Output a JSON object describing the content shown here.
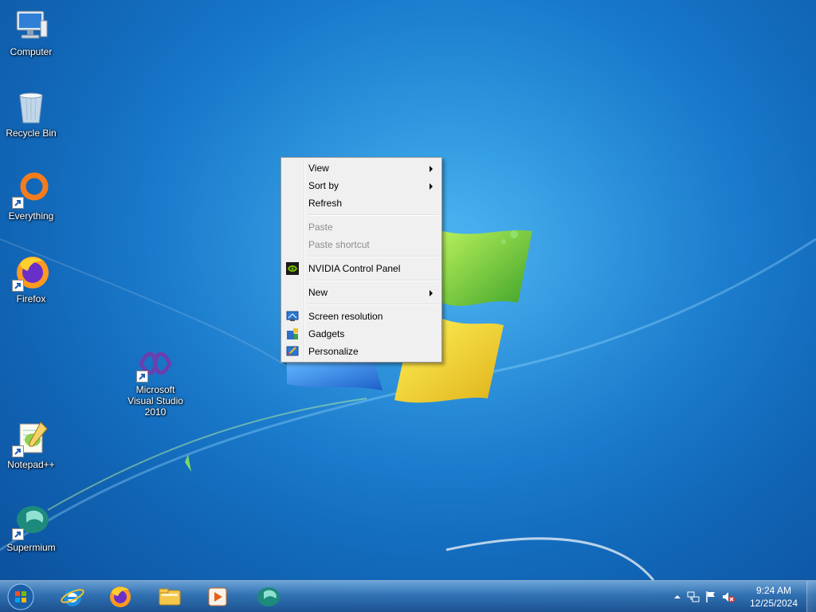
{
  "desktop": {
    "icons": [
      {
        "label": "Computer",
        "icon": "computer-icon"
      },
      {
        "label": "Recycle Bin",
        "icon": "recycle-bin-icon"
      },
      {
        "label": "Everything",
        "icon": "everything-icon"
      },
      {
        "label": "Firefox",
        "icon": "firefox-icon"
      },
      {
        "label": "Microsoft\nVisual Studio\n2010",
        "icon": "visual-studio-icon"
      },
      {
        "label": "Notepad++",
        "icon": "notepad-plus-plus-icon"
      },
      {
        "label": "Supermium",
        "icon": "supermium-icon"
      }
    ]
  },
  "context_menu": {
    "items": [
      {
        "label": "View",
        "submenu": true,
        "enabled": true
      },
      {
        "label": "Sort by",
        "submenu": true,
        "enabled": true
      },
      {
        "label": "Refresh",
        "submenu": false,
        "enabled": true
      },
      {
        "label": "Paste",
        "submenu": false,
        "enabled": false
      },
      {
        "label": "Paste shortcut",
        "submenu": false,
        "enabled": false
      },
      {
        "label": "NVIDIA Control Panel",
        "submenu": false,
        "enabled": true,
        "icon": "nvidia-icon"
      },
      {
        "label": "New",
        "submenu": true,
        "enabled": true
      },
      {
        "label": "Screen resolution",
        "submenu": false,
        "enabled": true,
        "icon": "screen-resolution-icon"
      },
      {
        "label": "Gadgets",
        "submenu": false,
        "enabled": true,
        "icon": "gadgets-icon"
      },
      {
        "label": "Personalize",
        "submenu": false,
        "enabled": true,
        "icon": "personalize-icon"
      }
    ]
  },
  "taskbar": {
    "start_icon": "windows-orb-icon",
    "pinned": [
      {
        "name": "Internet Explorer",
        "icon": "internet-explorer-icon"
      },
      {
        "name": "Firefox",
        "icon": "firefox-icon"
      },
      {
        "name": "Windows Explorer",
        "icon": "file-explorer-icon"
      },
      {
        "name": "Media Player",
        "icon": "media-player-icon"
      },
      {
        "name": "Supermium",
        "icon": "supermium-icon"
      }
    ],
    "tray": {
      "icons": [
        "show-hidden-icons-icon",
        "network-icon",
        "action-center-flag-icon",
        "volume-muted-icon"
      ],
      "time": "9:24 AM",
      "date": "12/25/2024"
    }
  },
  "colors": {
    "desktop_blue": "#1676c9",
    "menu_background": "#f0f0f0",
    "disabled_text": "#8d8d8d"
  }
}
